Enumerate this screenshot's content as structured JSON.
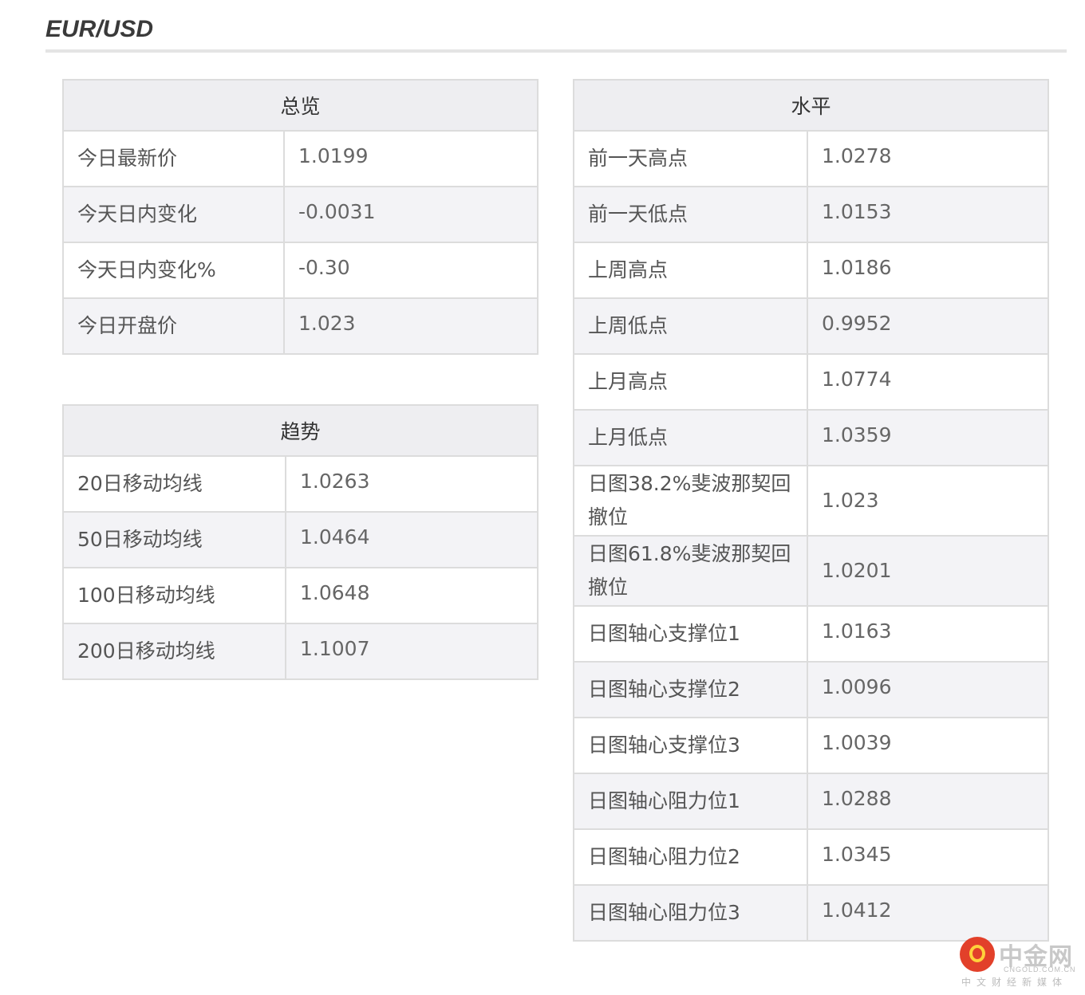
{
  "header": {
    "title": "EUR/USD"
  },
  "overview": {
    "heading": "总览",
    "rows": [
      {
        "label": "今日最新价",
        "value": "1.0199"
      },
      {
        "label": "今天日内变化",
        "value": "-0.0031"
      },
      {
        "label": "今天日内变化%",
        "value": "-0.30"
      },
      {
        "label": "今日开盘价",
        "value": "1.023"
      }
    ]
  },
  "trend": {
    "heading": "趋势",
    "rows": [
      {
        "label": "20日移动均线",
        "value": "1.0263"
      },
      {
        "label": "50日移动均线",
        "value": "1.0464"
      },
      {
        "label": "100日移动均线",
        "value": "1.0648"
      },
      {
        "label": "200日移动均线",
        "value": "1.1007"
      }
    ]
  },
  "levels": {
    "heading": "水平",
    "rows": [
      {
        "label": "前一天高点",
        "value": "1.0278"
      },
      {
        "label": "前一天低点",
        "value": "1.0153"
      },
      {
        "label": "上周高点",
        "value": "1.0186"
      },
      {
        "label": "上周低点",
        "value": "0.9952"
      },
      {
        "label": "上月高点",
        "value": "1.0774"
      },
      {
        "label": "上月低点",
        "value": "1.0359"
      },
      {
        "label": "日图38.2%斐波那契回撤位",
        "value": "1.023"
      },
      {
        "label": "日图61.8%斐波那契回撤位",
        "value": "1.0201"
      },
      {
        "label": "日图轴心支撑位1",
        "value": "1.0163"
      },
      {
        "label": "日图轴心支撑位2",
        "value": "1.0096"
      },
      {
        "label": "日图轴心支撑位3",
        "value": "1.0039"
      },
      {
        "label": "日图轴心阻力位1",
        "value": "1.0288"
      },
      {
        "label": "日图轴心阻力位2",
        "value": "1.0345"
      },
      {
        "label": "日图轴心阻力位3",
        "value": "1.0412"
      }
    ]
  },
  "watermark": {
    "name": "中金网",
    "domain": "CNGOLD.COM.CN",
    "tagline": "中文财经新媒体",
    "icon": "cngold-logo-icon",
    "colors": {
      "circle": "#e2402a",
      "swirl": "#ffd23b",
      "text": "#c8c8c8"
    }
  }
}
